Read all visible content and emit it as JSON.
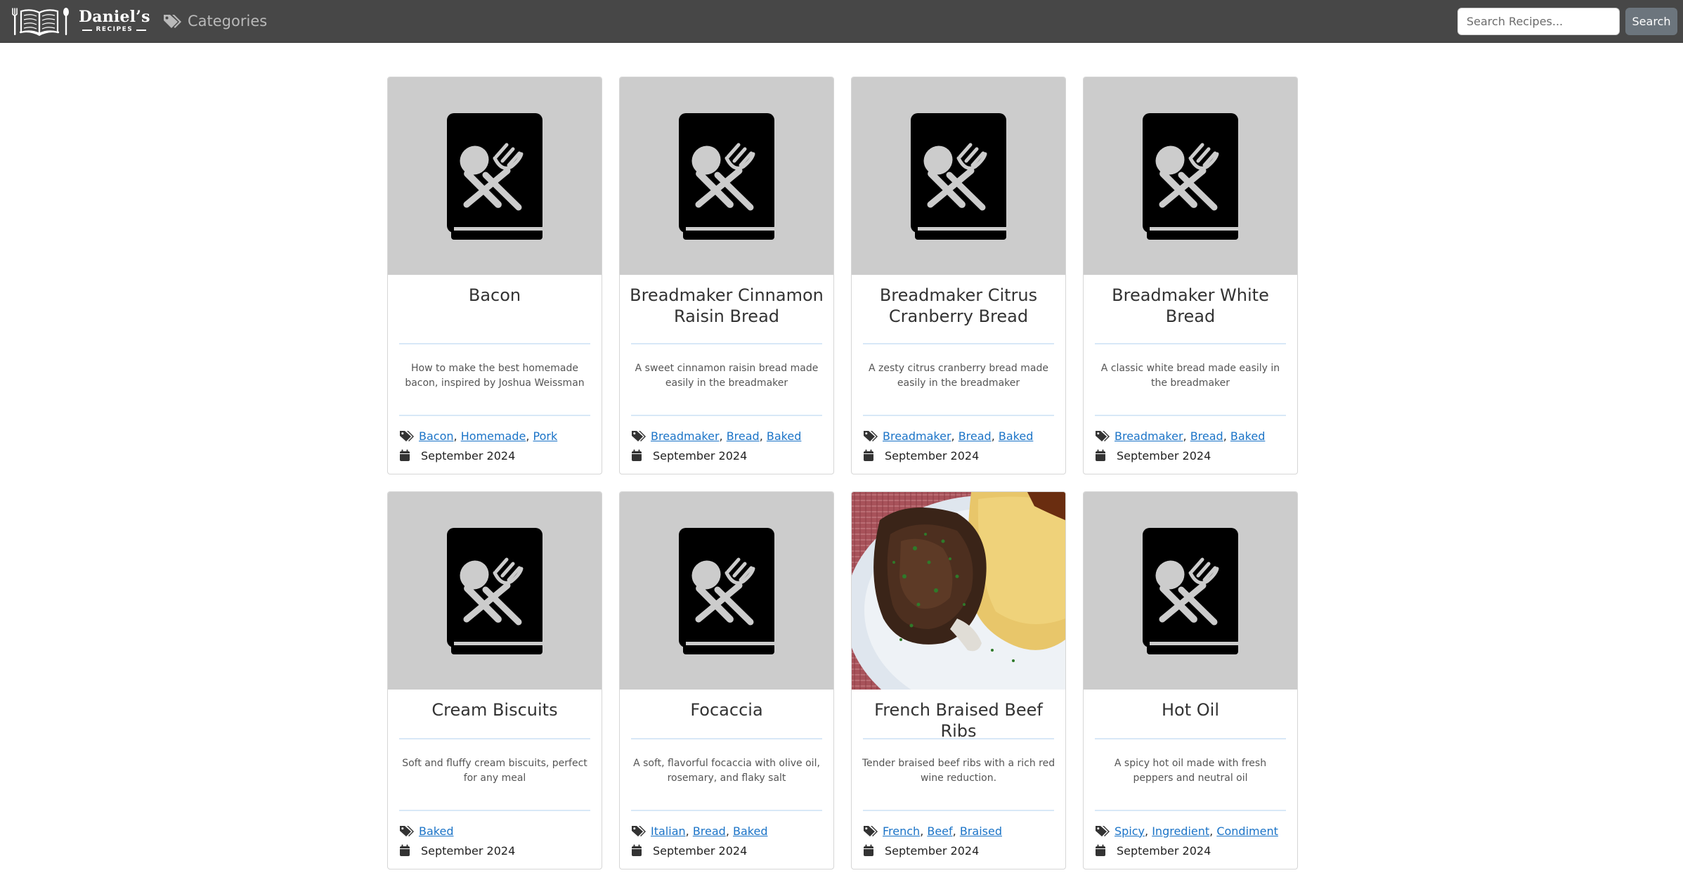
{
  "navbar": {
    "brand_name": "Daniel’s",
    "brand_sub": "RECIPES",
    "categories_label": "Categories",
    "search": {
      "placeholder": "Search Recipes...",
      "value": "",
      "button_label": "Search"
    }
  },
  "colors": {
    "navbar_bg": "#474747",
    "card_image_bg": "#cccccc",
    "link": "#1a73c7",
    "search_button": "#6c757d",
    "divider": "#d8e8f7"
  },
  "recipes": [
    {
      "title": "Bacon",
      "description": "How to make the best homemade bacon, inspired by Joshua Weissman",
      "tags": [
        "Bacon",
        "Homemade",
        "Pork"
      ],
      "date": "September 2024",
      "image": "recipe-book-icon"
    },
    {
      "title": "Breadmaker Cinnamon Raisin Bread",
      "description": "A sweet cinnamon raisin bread made easily in the breadmaker",
      "tags": [
        "Breadmaker",
        "Bread",
        "Baked"
      ],
      "date": "September 2024",
      "image": "recipe-book-icon"
    },
    {
      "title": "Breadmaker Citrus Cranberry Bread",
      "description": "A zesty citrus cranberry bread made easily in the breadmaker",
      "tags": [
        "Breadmaker",
        "Bread",
        "Baked"
      ],
      "date": "September 2024",
      "image": "recipe-book-icon"
    },
    {
      "title": "Breadmaker White Bread",
      "description": "A classic white bread made easily in the breadmaker",
      "tags": [
        "Breadmaker",
        "Bread",
        "Baked"
      ],
      "date": "September 2024",
      "image": "recipe-book-icon"
    },
    {
      "title": "Cream Biscuits",
      "description": "Soft and fluffy cream biscuits, perfect for any meal",
      "tags": [
        "Baked"
      ],
      "date": "September 2024",
      "image": "recipe-book-icon"
    },
    {
      "title": "Focaccia",
      "description": "A soft, flavorful focaccia with olive oil, rosemary, and flaky salt",
      "tags": [
        "Italian",
        "Bread",
        "Baked"
      ],
      "date": "September 2024",
      "image": "recipe-book-icon"
    },
    {
      "title": "French Braised Beef Ribs",
      "description": "Tender braised beef ribs with a rich red wine reduction.",
      "tags": [
        "French",
        "Beef",
        "Braised"
      ],
      "date": "September 2024",
      "image": "beef-ribs-photo"
    },
    {
      "title": "Hot Oil",
      "description": "A spicy hot oil made with fresh peppers and neutral oil",
      "tags": [
        "Spicy",
        "Ingredient",
        "Condiment"
      ],
      "date": "September 2024",
      "image": "recipe-book-icon"
    }
  ]
}
